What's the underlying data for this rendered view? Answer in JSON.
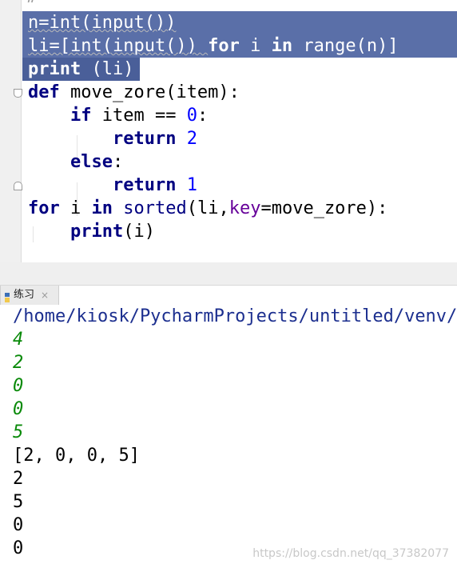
{
  "editor": {
    "top_partial": "#",
    "lines": [
      {
        "tokens": [
          {
            "t": "n=int(input())"
          }
        ]
      },
      {
        "tokens": [
          {
            "t": "li=[int(input()) "
          },
          {
            "t": "for",
            "c": "kw"
          },
          {
            "t": " i "
          },
          {
            "t": "in",
            "c": "kw"
          },
          {
            "t": " range(n)]"
          }
        ]
      },
      {
        "tokens": [
          {
            "t": "print",
            "c": "kw"
          },
          {
            "t": " (li)"
          }
        ]
      },
      {
        "tokens": [
          {
            "t": "def",
            "c": "kw"
          },
          {
            "t": " move_zore(item):"
          }
        ]
      },
      {
        "tokens": [
          {
            "t": "    "
          },
          {
            "t": "if",
            "c": "kw"
          },
          {
            "t": " item == "
          },
          {
            "t": "0",
            "c": "num"
          },
          {
            "t": ":"
          }
        ]
      },
      {
        "tokens": [
          {
            "t": "        "
          },
          {
            "t": "return",
            "c": "kw"
          },
          {
            "t": " "
          },
          {
            "t": "2",
            "c": "num"
          }
        ]
      },
      {
        "tokens": [
          {
            "t": "    "
          },
          {
            "t": "else",
            "c": "kw"
          },
          {
            "t": ":"
          }
        ]
      },
      {
        "tokens": [
          {
            "t": "        "
          },
          {
            "t": "return",
            "c": "kw"
          },
          {
            "t": " "
          },
          {
            "t": "1",
            "c": "num"
          }
        ]
      },
      {
        "tokens": [
          {
            "t": "for",
            "c": "kw"
          },
          {
            "t": " i "
          },
          {
            "t": "in",
            "c": "kw"
          },
          {
            "t": " "
          },
          {
            "t": "sorted",
            "c": "bi"
          },
          {
            "t": "(li,"
          },
          {
            "t": "key",
            "c": "kwarg"
          },
          {
            "t": "=move_zore):"
          }
        ]
      },
      {
        "tokens": [
          {
            "t": "    "
          },
          {
            "t": "print",
            "c": "kw"
          },
          {
            "t": "(i)"
          }
        ]
      }
    ]
  },
  "run_panel": {
    "tab_label": "练习",
    "close_glyph": "×"
  },
  "console": {
    "lines": [
      {
        "text": "/home/kiosk/PycharmProjects/untitled/venv/bin/python",
        "kind": "path"
      },
      {
        "text": "4",
        "kind": "input"
      },
      {
        "text": "2",
        "kind": "input"
      },
      {
        "text": "0",
        "kind": "input"
      },
      {
        "text": "0",
        "kind": "input"
      },
      {
        "text": "5",
        "kind": "input"
      },
      {
        "text": "[2, 0, 0, 5]",
        "kind": "output"
      },
      {
        "text": "2",
        "kind": "output"
      },
      {
        "text": "5",
        "kind": "output"
      },
      {
        "text": "0",
        "kind": "output"
      },
      {
        "text": "0",
        "kind": "output"
      }
    ]
  },
  "watermark": "https://blog.csdn.net/qq_37382077",
  "colors": {
    "selection": "#5a6fa8",
    "keyword": "#000080",
    "number": "#0000ff",
    "kwarg": "#660099",
    "console_input": "#0a8a0a",
    "console_path": "#1c2f8f"
  }
}
